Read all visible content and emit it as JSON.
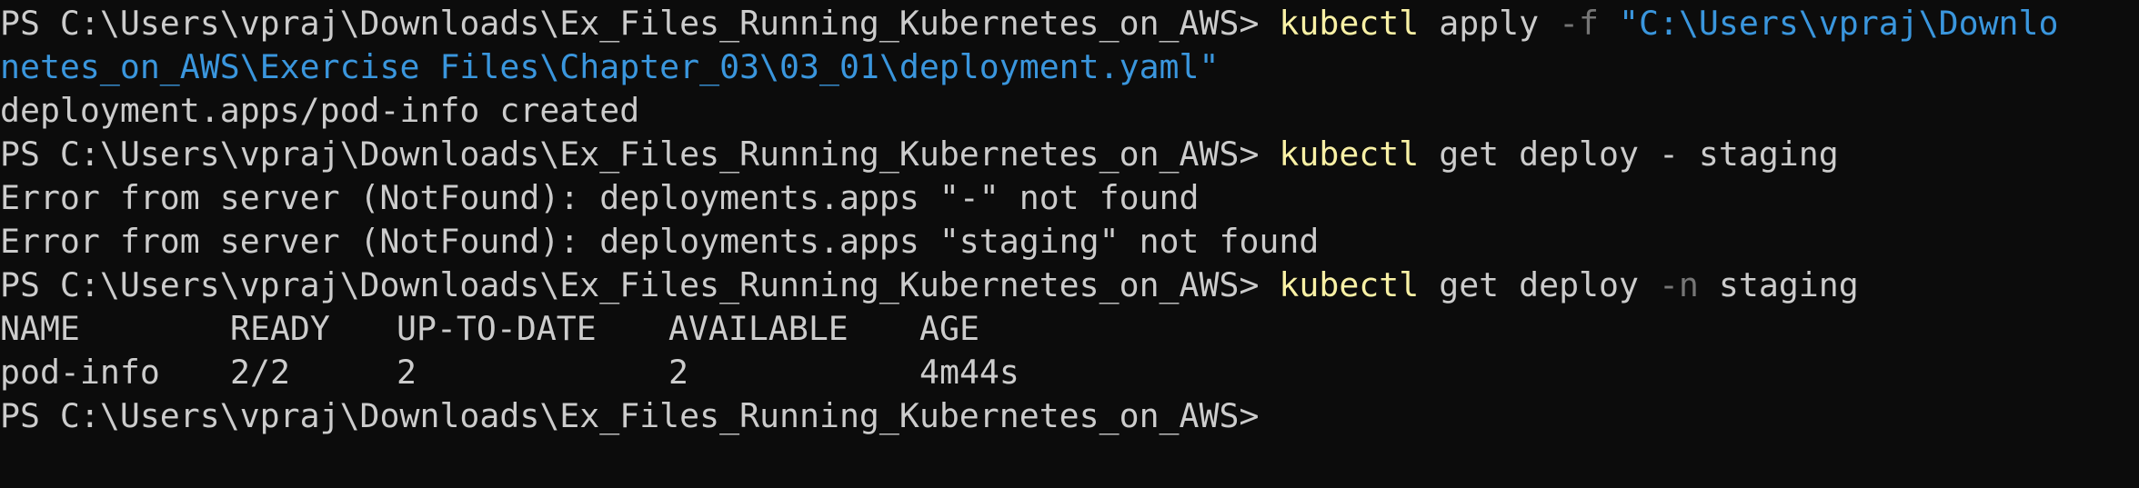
{
  "terminal": {
    "prompt": "PS C:\\Users\\vpraj\\Downloads\\Ex_Files_Running_Kubernetes_on_AWS>",
    "line1": {
      "cmd": "kubectl",
      "arg1": "apply",
      "flag": "-f",
      "path_start": "\"C:\\Users\\vpraj\\Downlo"
    },
    "line2": {
      "path_cont": "netes_on_AWS\\Exercise Files\\Chapter_03\\03_01\\deployment.yaml\""
    },
    "line3": "deployment.apps/pod-info created",
    "line4": {
      "cmd": "kubectl",
      "args": "get deploy - staging"
    },
    "line5": "Error from server (NotFound): deployments.apps \"-\" not found",
    "line6": "Error from server (NotFound): deployments.apps \"staging\" not found",
    "line7": {
      "cmd": "kubectl",
      "arg1": "get deploy",
      "flag": "-n",
      "arg2": "staging"
    },
    "table": {
      "headers": [
        "NAME",
        "READY",
        "UP-TO-DATE",
        "AVAILABLE",
        "AGE"
      ],
      "rows": [
        [
          "pod-info",
          "2/2",
          "2",
          "2",
          "4m44s"
        ]
      ]
    }
  },
  "colors": {
    "background": "#0c0c0c",
    "text": "#cccccc",
    "command": "#f9f1a5",
    "flag": "#767676",
    "string": "#3a96dd"
  }
}
